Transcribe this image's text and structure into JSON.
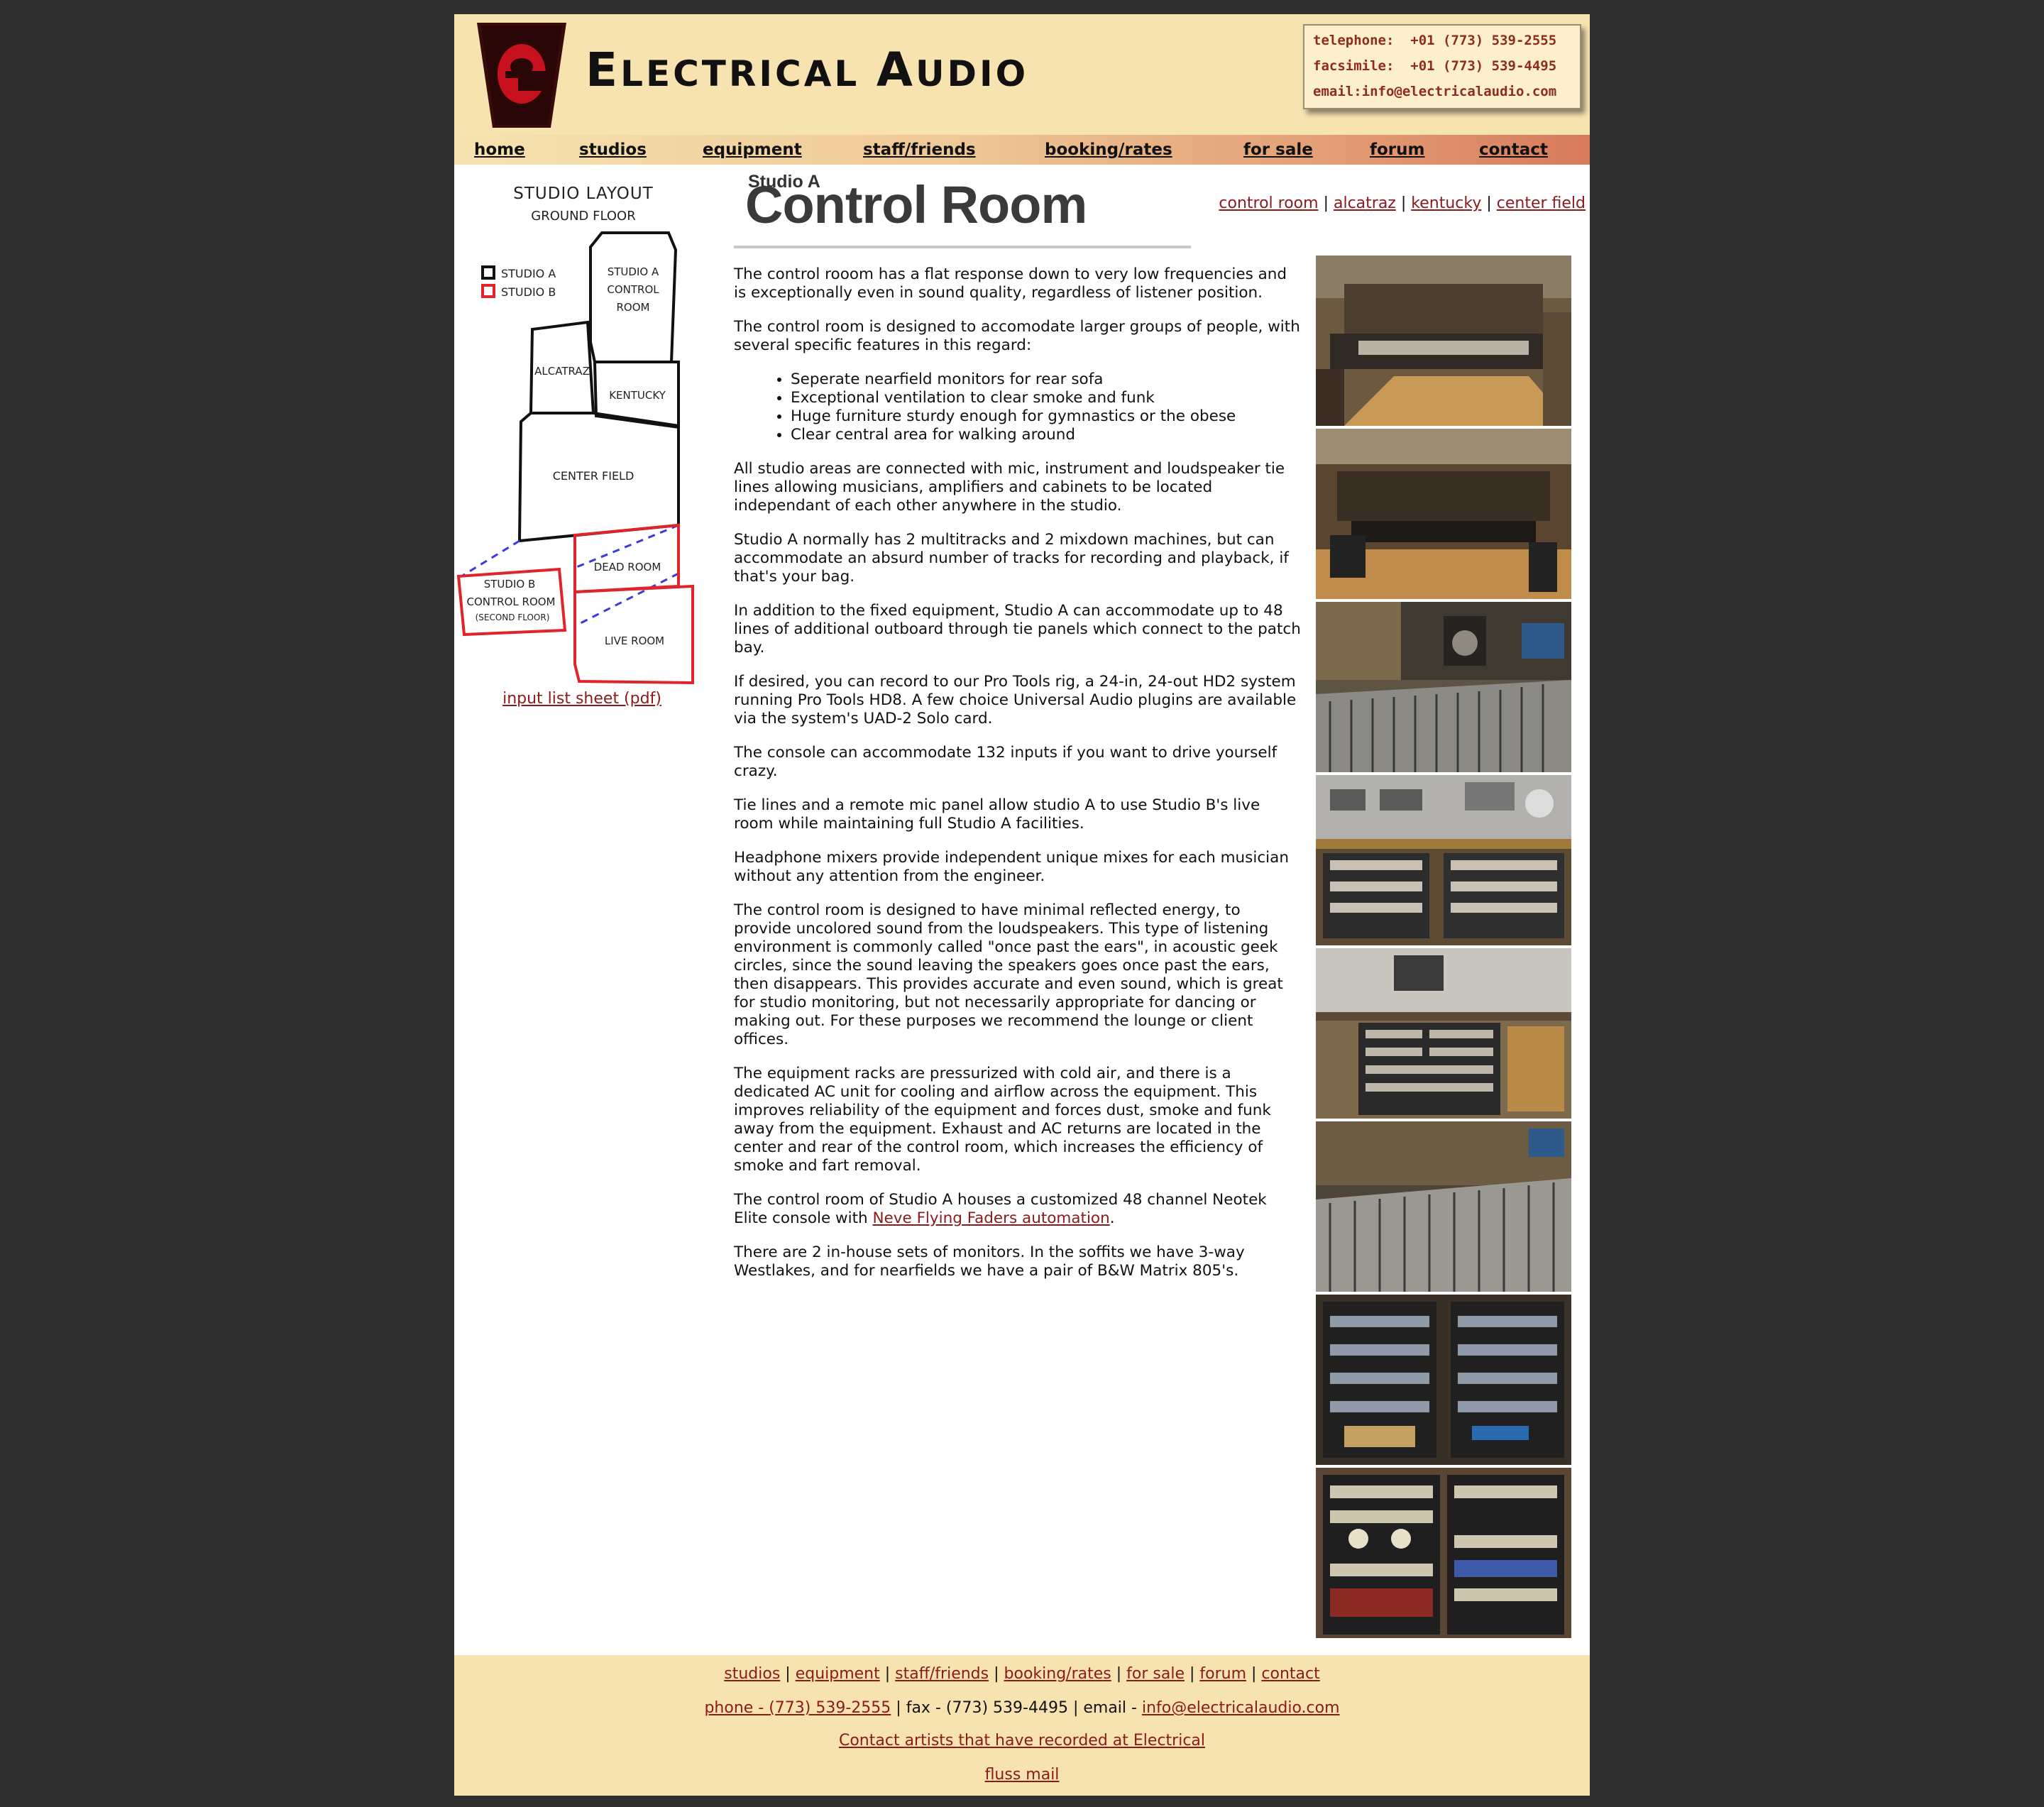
{
  "header": {
    "brand": {
      "initial": "E",
      "rest1": "LECTRICAL",
      "initial2": "A",
      "rest2": "UDIO"
    },
    "contact_lines": [
      "telephone:  +01 (773) 539-2555",
      "facsimile:  +01 (773) 539-4495",
      "email:info@electricalaudio.com"
    ]
  },
  "nav": [
    "home",
    "studios",
    "equipment",
    "staff/friends",
    "booking/rates",
    "for sale",
    "forum",
    "contact"
  ],
  "floorplan": {
    "title": "STUDIO LAYOUT",
    "subtitle": "GROUND FLOOR",
    "legend": [
      "STUDIO A",
      "STUDIO B"
    ],
    "rooms": {
      "control_room": [
        "STUDIO A",
        "CONTROL",
        "ROOM"
      ],
      "alcatraz": "ALCATRAZ",
      "kentucky": "KENTUCKY",
      "center_field": "CENTER FIELD",
      "dead_room": "DEAD ROOM",
      "live_room": "LIVE ROOM",
      "b_control": [
        "STUDIO B",
        "CONTROL ROOM",
        "(SECOND FLOOR)"
      ]
    },
    "colors": {
      "studio_a": "#111111",
      "studio_b": "#e0242b",
      "connector": "#3b3bdc"
    }
  },
  "pdf_link": "input list sheet (pdf)",
  "page": {
    "kicker": "Studio A",
    "title": "Control Room",
    "subnav": [
      "control room",
      "alcatraz",
      "kentucky",
      "center field"
    ]
  },
  "content": {
    "p1": "The control rooom has a flat response down to very low frequencies and is exceptionally even in sound quality, regardless of listener position.",
    "p2": "The control room is designed to accomodate larger groups of people, with several specific features in this regard:",
    "features": [
      "Seperate nearfield monitors for rear sofa",
      "Exceptional ventilation to clear smoke and funk",
      "Huge furniture sturdy enough for gymnastics or the obese",
      "Clear central area for walking around"
    ],
    "p3": "All studio areas are connected with mic, instrument and loudspeaker tie lines allowing musicians, amplifiers and cabinets to be located independant of each other anywhere in the studio.",
    "p4": "Studio A normally has 2 multitracks and 2 mixdown machines, but can accommodate an absurd number of tracks for recording and playback, if that's your bag.",
    "p5": "In addition to the fixed equipment, Studio A can accommodate up to 48 lines of additional outboard through tie panels which connect to the patch bay.",
    "p6": "If desired, you can record to our Pro Tools rig, a 24-in, 24-out HD2 system running Pro Tools HD8. A few choice Universal Audio plugins are available via the system's UAD-2 Solo card.",
    "p7": "The console can accommodate 132 inputs if you want to drive yourself crazy.",
    "p8": "Tie lines and a remote mic panel allow studio A to use Studio B's live room while maintaining full Studio A facilities.",
    "p9": "Headphone mixers provide independent unique mixes for each musician without any attention from the engineer.",
    "p10": "The control room is designed to have minimal reflected energy, to provide uncolored sound from the loudspeakers. This type of listening environment is commonly called \"once past the ears\", in acoustic geek circles, since the sound leaving the speakers goes once past the ears, then disappears. This provides accurate and even sound, which is great for studio monitoring, but not necessarily appropriate for dancing or making out. For these purposes we recommend the lounge or client offices.",
    "p11": "The equipment racks are pressurized with cold air, and there is a dedicated AC unit for cooling and airflow across the equipment. This improves reliability of the equipment and forces dust, smoke and funk away from the equipment. Exhaust and AC returns are located in the center and rear of the control room, which increases the efficiency of smoke and fart removal.",
    "p12_pre": "The control room of Studio A houses a customized 48 channel Neotek Elite console with ",
    "p12_link": "Neve Flying Faders automation",
    "p12_post": ".",
    "p13": "There are 2 in-house sets of monitors. In the soffits we have 3-way Westlakes, and for nearfields we have a pair of B&W Matrix 805's."
  },
  "footer": {
    "links": [
      "studios",
      "equipment",
      "staff/friends",
      "booking/rates",
      "for sale",
      "forum",
      "contact"
    ],
    "phone_link": "phone - (773) 539-2555",
    "fax": "fax - (773) 539-4495",
    "email_label": "email - ",
    "email_link": "info@electricalaudio.com",
    "artists_link": "Contact artists that have recorded at Electrical",
    "fluss_link": "fluss mail"
  },
  "colors": {
    "page_bg": "#2f2f2f",
    "header_bg": "#f6e3b0",
    "link": "#8b1a1a",
    "logo_red": "#c8111e"
  }
}
